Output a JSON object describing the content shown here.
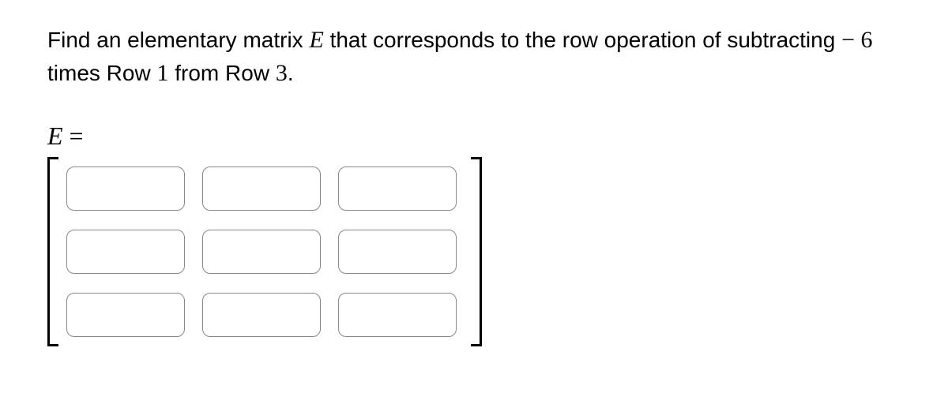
{
  "question": {
    "part1": "Find an elementary matrix ",
    "var_E": "E",
    "part2": " that corresponds to the row operation of subtracting ",
    "minus": "−",
    "space": " ",
    "coef": "6",
    "part3": " times Row ",
    "row_from": "1",
    "part4": " from Row ",
    "row_to": "3",
    "part5": "."
  },
  "eq_label": {
    "E": "E",
    "equals": " ="
  },
  "matrix": {
    "rows": 3,
    "cols": 3,
    "values": [
      [
        "",
        "",
        ""
      ],
      [
        "",
        "",
        ""
      ],
      [
        "",
        "",
        ""
      ]
    ]
  }
}
